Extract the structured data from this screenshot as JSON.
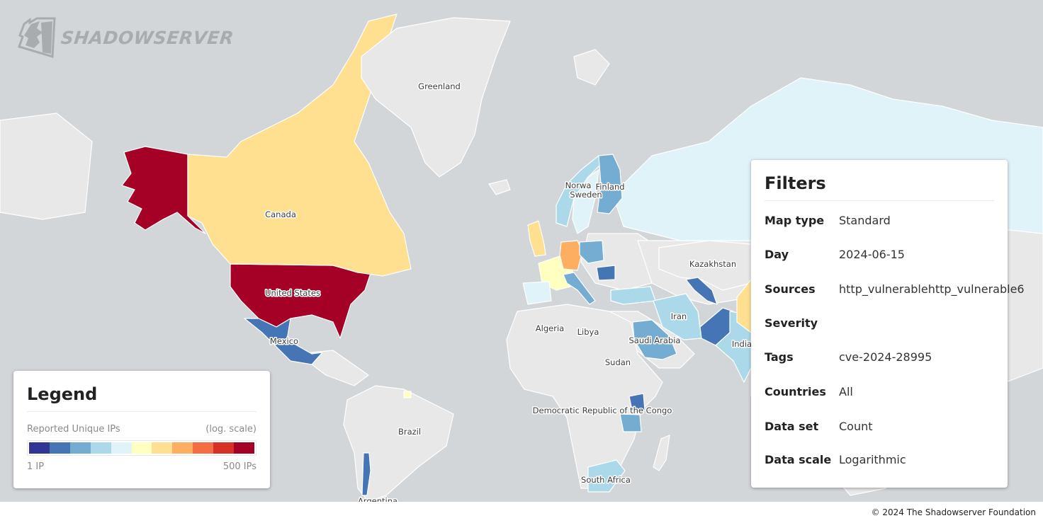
{
  "brand": {
    "logo_text": "SHADOWSERVER",
    "logo_icon": "shadowserver-logo-icon"
  },
  "map": {
    "ocean_color": "#d3d6d9",
    "no_data_color": "#e8e8e9",
    "countries": [
      {
        "id": "alaska",
        "name": "United States (Alaska)",
        "bucket": 10,
        "label": ""
      },
      {
        "id": "usa",
        "name": "United States",
        "bucket": 10,
        "label": "United States"
      },
      {
        "id": "canada",
        "name": "Canada",
        "bucket": 6,
        "label": "Canada"
      },
      {
        "id": "mexico",
        "name": "Mexico",
        "bucket": 1,
        "label": "Mexico"
      },
      {
        "id": "greenland",
        "name": "Greenland",
        "bucket": null,
        "label": "Greenland"
      },
      {
        "id": "russia",
        "name": "Russia",
        "bucket": 4,
        "label": ""
      },
      {
        "id": "kazakhstan",
        "name": "Kazakhstan",
        "bucket": null,
        "label": "Kazakhstan"
      },
      {
        "id": "norway",
        "name": "Norway",
        "bucket": 3,
        "label": "Norwa"
      },
      {
        "id": "sweden",
        "name": "Sweden",
        "bucket": 4,
        "label": "Sweden"
      },
      {
        "id": "finland",
        "name": "Finland",
        "bucket": 2,
        "label": "Finland"
      },
      {
        "id": "uk",
        "name": "United Kingdom",
        "bucket": 6,
        "label": ""
      },
      {
        "id": "france",
        "name": "France",
        "bucket": 5,
        "label": ""
      },
      {
        "id": "germany",
        "name": "Germany",
        "bucket": 7,
        "label": ""
      },
      {
        "id": "poland",
        "name": "Poland",
        "bucket": 2,
        "label": ""
      },
      {
        "id": "romania",
        "name": "Romania",
        "bucket": 1,
        "label": ""
      },
      {
        "id": "italy",
        "name": "Italy",
        "bucket": 2,
        "label": ""
      },
      {
        "id": "spain",
        "name": "Spain",
        "bucket": 4,
        "label": ""
      },
      {
        "id": "turkey",
        "name": "Turkey",
        "bucket": 3,
        "label": ""
      },
      {
        "id": "iran",
        "name": "Iran",
        "bucket": 3,
        "label": "Iran"
      },
      {
        "id": "uzbekistan",
        "name": "Uzbekistan",
        "bucket": 1,
        "label": ""
      },
      {
        "id": "pakistan",
        "name": "Pakistan",
        "bucket": 1,
        "label": ""
      },
      {
        "id": "india",
        "name": "India",
        "bucket": 3,
        "label": "India"
      },
      {
        "id": "china",
        "name": "China",
        "bucket": 6,
        "label": ""
      },
      {
        "id": "saudi",
        "name": "Saudi Arabia",
        "bucket": 2,
        "label": "Saudi Arabia"
      },
      {
        "id": "africa",
        "name": "Africa (other)",
        "bucket": null,
        "label": ""
      },
      {
        "id": "kenya",
        "name": "Kenya",
        "bucket": 1,
        "label": ""
      },
      {
        "id": "tanzania",
        "name": "Tanzania",
        "bucket": 2,
        "label": ""
      },
      {
        "id": "southafrica",
        "name": "South Africa",
        "bucket": 3,
        "label": "South Africa"
      },
      {
        "id": "southamerica",
        "name": "South America (other)",
        "bucket": null,
        "label": "Brazil"
      },
      {
        "id": "chile",
        "name": "Chile",
        "bucket": 1,
        "label": ""
      },
      {
        "id": "guiana",
        "name": "French Guiana",
        "bucket": 5,
        "label": ""
      }
    ],
    "extra_labels": [
      {
        "id": "algeria",
        "text": "Algeria"
      },
      {
        "id": "libya",
        "text": "Libya"
      },
      {
        "id": "sudan",
        "text": "Sudan"
      },
      {
        "id": "drc",
        "text": "Democratic Republic of the Congo"
      },
      {
        "id": "argentina",
        "text": "Argentina"
      }
    ]
  },
  "legend": {
    "title": "Legend",
    "metric": "Reported Unique IPs",
    "scale_note": "(log. scale)",
    "min_label": "1 IP",
    "max_label": "500 IPs",
    "colors": [
      "#313695",
      "#4575b4",
      "#74add1",
      "#abd9e9",
      "#e0f3f8",
      "#ffffbf",
      "#fee090",
      "#fdae61",
      "#f46d43",
      "#d73027",
      "#a50026"
    ]
  },
  "filters": {
    "title": "Filters",
    "rows": [
      {
        "label": "Map type",
        "value": "Standard"
      },
      {
        "label": "Day",
        "value": "2024-06-15"
      },
      {
        "label": "Sources",
        "value": "http_vulnerablehttp_vulnerable6"
      },
      {
        "label": "Severity",
        "value": ""
      },
      {
        "label": "Tags",
        "value": "cve-2024-28995"
      },
      {
        "label": "Countries",
        "value": "All"
      },
      {
        "label": "Data set",
        "value": "Count"
      },
      {
        "label": "Data scale",
        "value": "Logarithmic"
      }
    ]
  },
  "footer": {
    "copyright": "© 2024 The Shadowserver Foundation"
  }
}
